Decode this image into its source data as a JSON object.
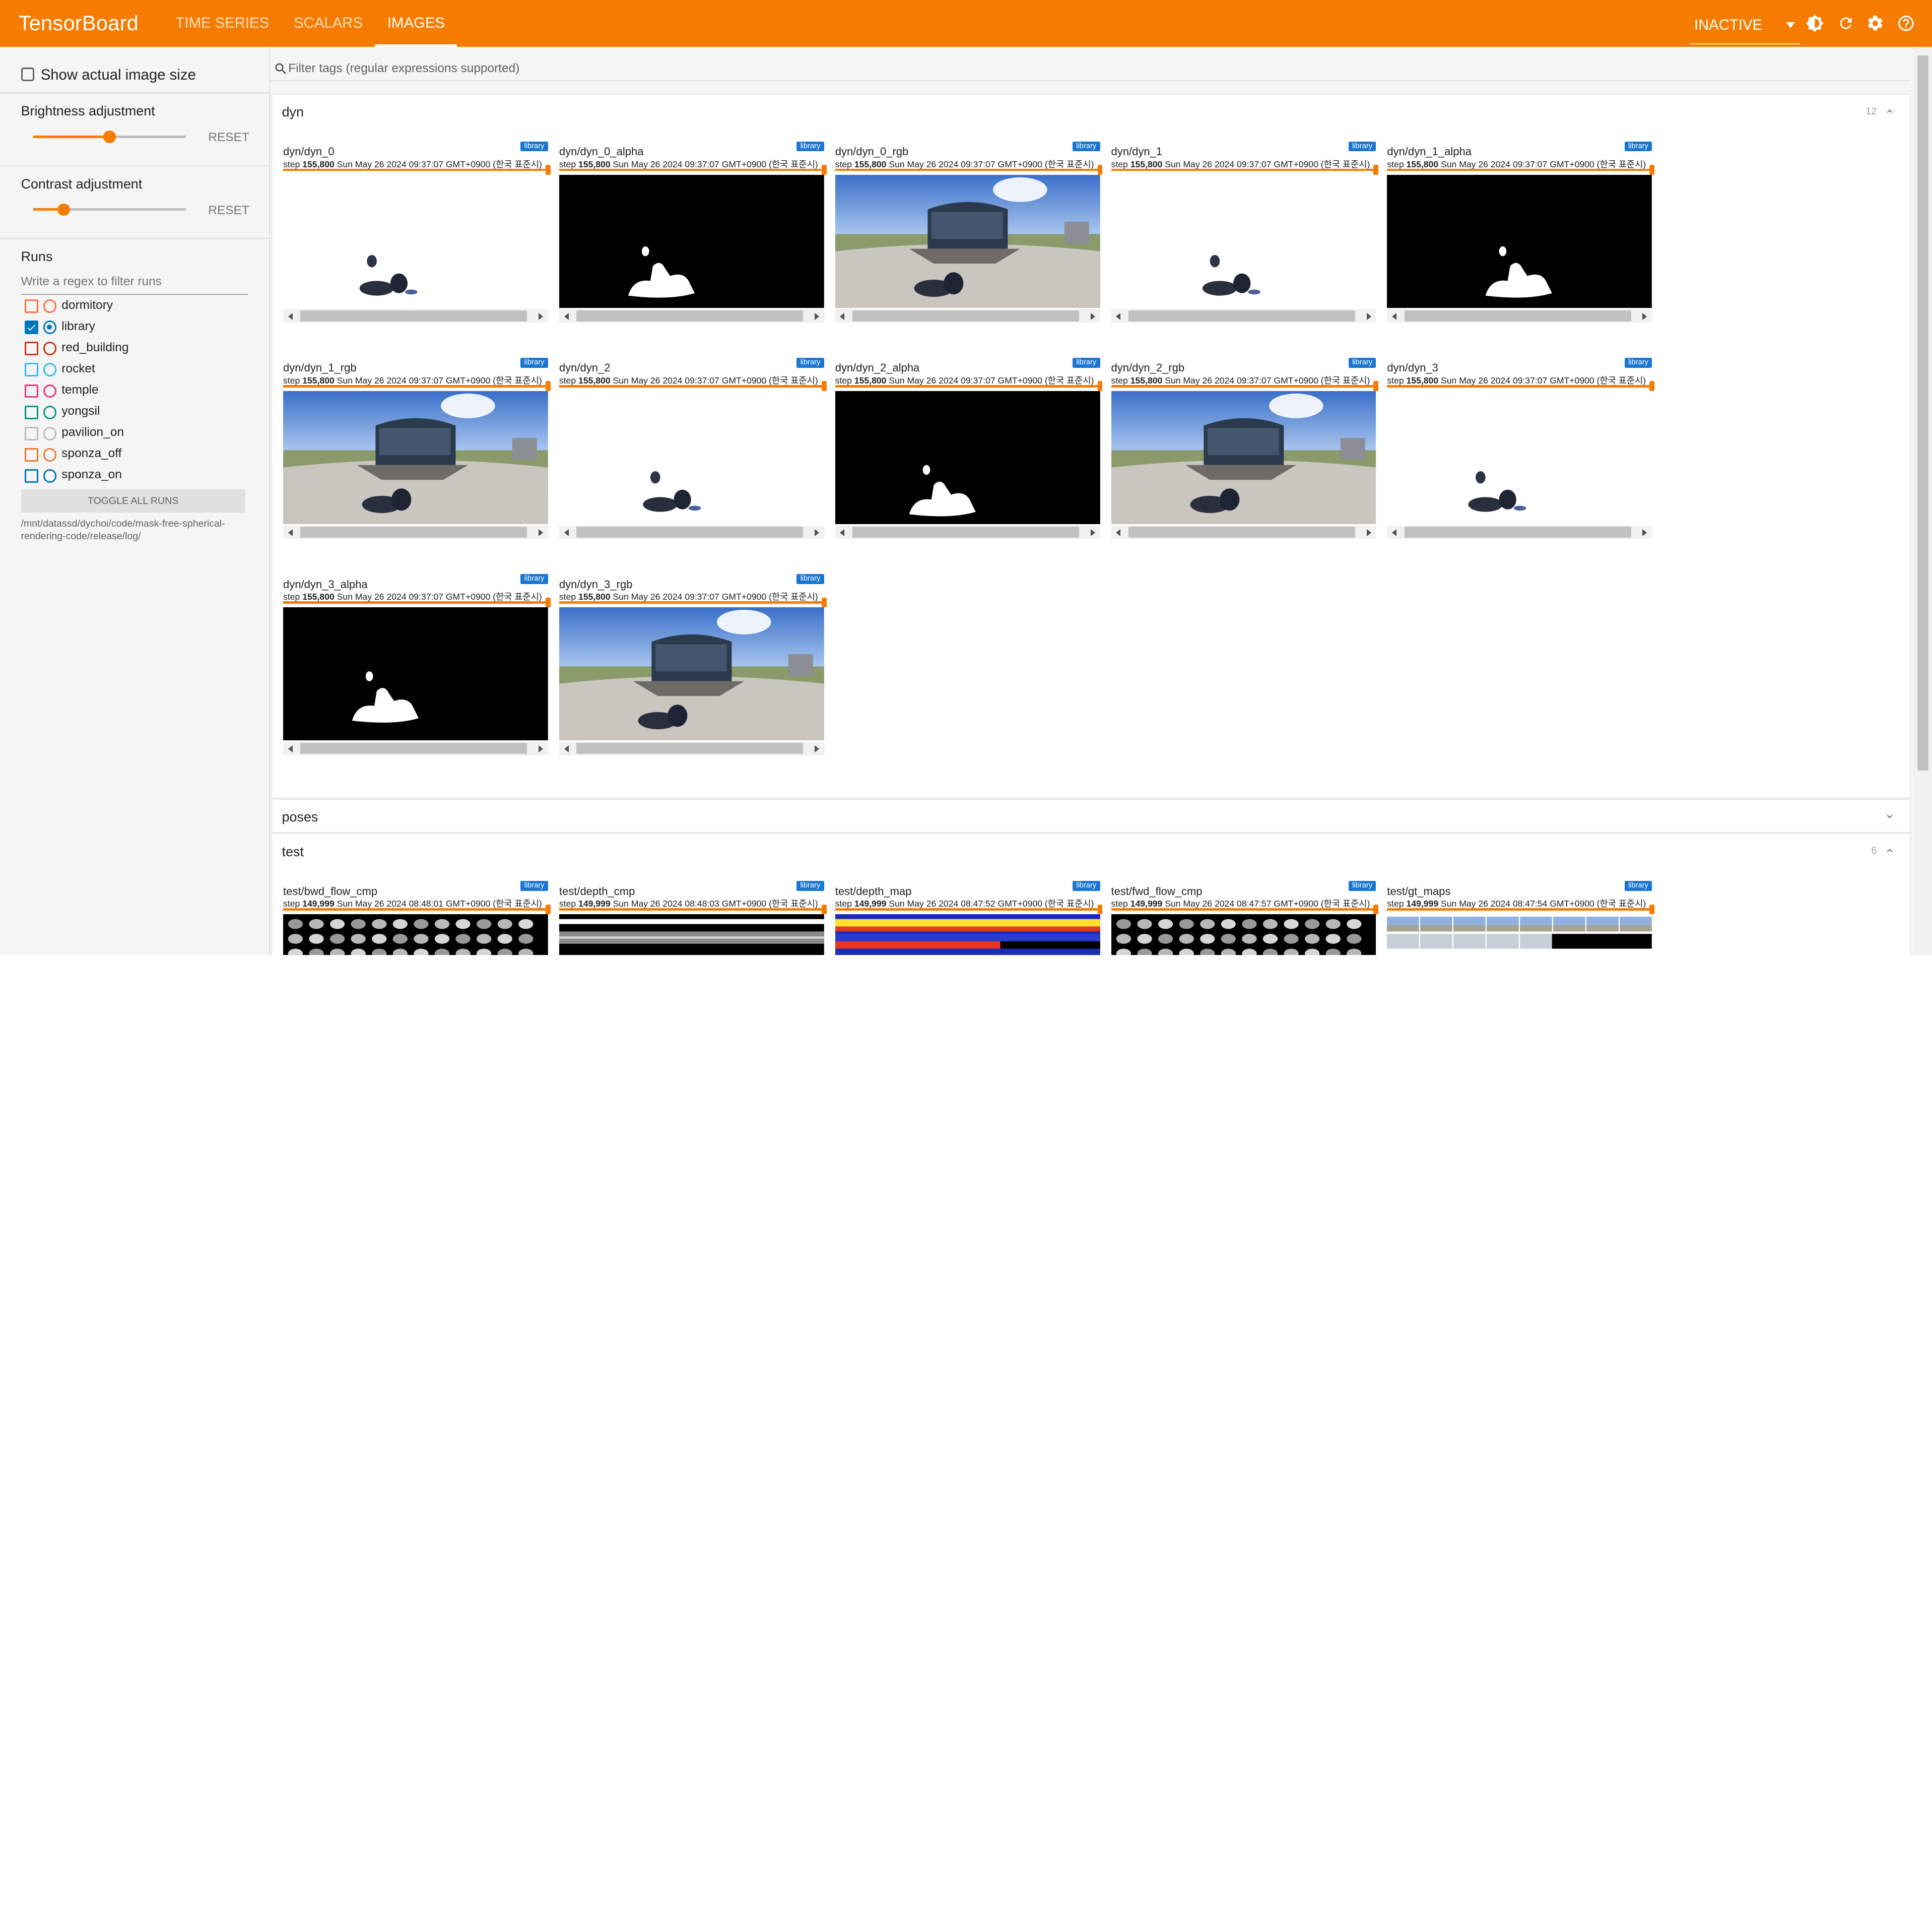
{
  "app": {
    "brand": "TensorBoard",
    "tabs": [
      {
        "label": "TIME SERIES",
        "active": false
      },
      {
        "label": "SCALARS",
        "active": false
      },
      {
        "label": "IMAGES",
        "active": true
      }
    ],
    "status_select": "INACTIVE",
    "icons": [
      "brightness-icon",
      "refresh-icon",
      "settings-icon",
      "help-icon"
    ],
    "accent_color": "#f57c00"
  },
  "sidebar": {
    "show_actual_size": {
      "label": "Show actual image size",
      "checked": false
    },
    "brightness": {
      "label": "Brightness adjustment",
      "reset": "RESET",
      "value": 0.5
    },
    "contrast": {
      "label": "Contrast adjustment",
      "reset": "RESET",
      "value": 0.2
    },
    "runs_title": "Runs",
    "runs_filter_placeholder": "Write a regex to filter runs",
    "runs": [
      {
        "name": "dormitory",
        "checked": false,
        "selected": false,
        "color": "#ff7043"
      },
      {
        "name": "library",
        "checked": true,
        "selected": true,
        "color": "#0077bb"
      },
      {
        "name": "red_building",
        "checked": false,
        "selected": false,
        "color": "#cc3311"
      },
      {
        "name": "rocket",
        "checked": false,
        "selected": false,
        "color": "#33bbee"
      },
      {
        "name": "temple",
        "checked": false,
        "selected": false,
        "color": "#ee3377"
      },
      {
        "name": "yongsil",
        "checked": false,
        "selected": false,
        "color": "#009988"
      },
      {
        "name": "pavilion_on",
        "checked": false,
        "selected": false,
        "color": "#bbbbbb"
      },
      {
        "name": "sponza_off",
        "checked": false,
        "selected": false,
        "color": "#ee7733"
      },
      {
        "name": "sponza_on",
        "checked": false,
        "selected": false,
        "color": "#0077bb"
      }
    ],
    "toggle_all": "TOGGLE ALL RUNS",
    "logdir": "/mnt/datassd/dychoi/code/mask-free-spherical-rendering-code/release/log/"
  },
  "main": {
    "filter_placeholder": "Filter tags (regular expressions supported)",
    "groups": [
      {
        "name": "dyn",
        "count": "12",
        "expanded": true,
        "cards": [
          {
            "title": "dyn/dyn_0",
            "run": "library",
            "step": "155,800",
            "time": "Sun May 26 2024 09:37:07 GMT+0900 (한국 표준시)",
            "kind": "mask-white"
          },
          {
            "title": "dyn/dyn_0_alpha",
            "run": "library",
            "step": "155,800",
            "time": "Sun May 26 2024 09:37:07 GMT+0900 (한국 표준시)",
            "kind": "alpha"
          },
          {
            "title": "dyn/dyn_0_rgb",
            "run": "library",
            "step": "155,800",
            "time": "Sun May 26 2024 09:37:07 GMT+0900 (한국 표준시)",
            "kind": "rgb"
          },
          {
            "title": "dyn/dyn_1",
            "run": "library",
            "step": "155,800",
            "time": "Sun May 26 2024 09:37:07 GMT+0900 (한국 표준시)",
            "kind": "mask-white"
          },
          {
            "title": "dyn/dyn_1_alpha",
            "run": "library",
            "step": "155,800",
            "time": "Sun May 26 2024 09:37:07 GMT+0900 (한국 표준시)",
            "kind": "alpha"
          },
          {
            "title": "dyn/dyn_1_rgb",
            "run": "library",
            "step": "155,800",
            "time": "Sun May 26 2024 09:37:07 GMT+0900 (한국 표준시)",
            "kind": "rgb"
          },
          {
            "title": "dyn/dyn_2",
            "run": "library",
            "step": "155,800",
            "time": "Sun May 26 2024 09:37:07 GMT+0900 (한국 표준시)",
            "kind": "mask-white"
          },
          {
            "title": "dyn/dyn_2_alpha",
            "run": "library",
            "step": "155,800",
            "time": "Sun May 26 2024 09:37:07 GMT+0900 (한국 표준시)",
            "kind": "alpha"
          },
          {
            "title": "dyn/dyn_2_rgb",
            "run": "library",
            "step": "155,800",
            "time": "Sun May 26 2024 09:37:07 GMT+0900 (한국 표준시)",
            "kind": "rgb"
          },
          {
            "title": "dyn/dyn_3",
            "run": "library",
            "step": "155,800",
            "time": "Sun May 26 2024 09:37:07 GMT+0900 (한국 표준시)",
            "kind": "mask-white"
          },
          {
            "title": "dyn/dyn_3_alpha",
            "run": "library",
            "step": "155,800",
            "time": "Sun May 26 2024 09:37:07 GMT+0900 (한국 표준시)",
            "kind": "alpha"
          },
          {
            "title": "dyn/dyn_3_rgb",
            "run": "library",
            "step": "155,800",
            "time": "Sun May 26 2024 09:37:07 GMT+0900 (한국 표준시)",
            "kind": "rgb"
          }
        ]
      },
      {
        "name": "poses",
        "count": "",
        "expanded": false,
        "cards": []
      },
      {
        "name": "test",
        "count": "6",
        "expanded": true,
        "cards": [
          {
            "title": "test/bwd_flow_cmp",
            "run": "library",
            "step": "149,999",
            "time": "Sun May 26 2024 08:48:01 GMT+0900 (한국 표준시)",
            "kind": "flow"
          },
          {
            "title": "test/depth_cmp",
            "run": "library",
            "step": "149,999",
            "time": "Sun May 26 2024 08:48:03 GMT+0900 (한국 표준시)",
            "kind": "depth-cmp"
          },
          {
            "title": "test/depth_map",
            "run": "library",
            "step": "149,999",
            "time": "Sun May 26 2024 08:47:52 GMT+0900 (한국 표준시)",
            "kind": "depth-map"
          },
          {
            "title": "test/fwd_flow_cmp",
            "run": "library",
            "step": "149,999",
            "time": "Sun May 26 2024 08:47:57 GMT+0900 (한국 표준시)",
            "kind": "flow"
          },
          {
            "title": "test/gt_maps",
            "run": "library",
            "step": "149,999",
            "time": "Sun May 26 2024 08:47:54 GMT+0900 (한국 표준시)",
            "kind": "gt"
          }
        ]
      }
    ]
  }
}
